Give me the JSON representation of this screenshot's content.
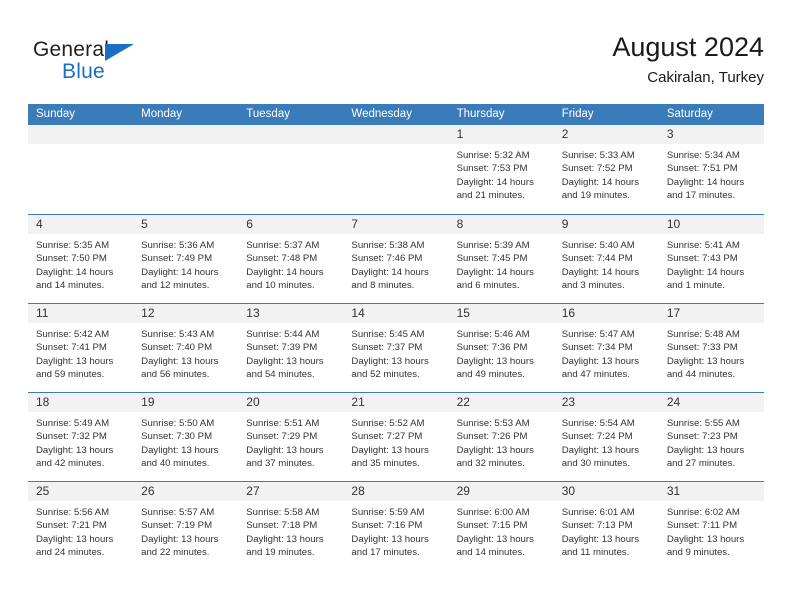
{
  "brand": {
    "name_top": "General",
    "name_bottom": "Blue",
    "accent_color": "#1b6ec2",
    "triangle_icon": "blue-triangle-icon"
  },
  "header": {
    "title": "August 2024",
    "subtitle": "Cakiralan, Turkey"
  },
  "theme": {
    "header_blue": "#3a7cba",
    "day_band_gray": "#f2f2f2",
    "text": "#333333"
  },
  "calendar": {
    "weekday_headers": [
      "Sunday",
      "Monday",
      "Tuesday",
      "Wednesday",
      "Thursday",
      "Friday",
      "Saturday"
    ],
    "weeks": [
      [
        {
          "day": "",
          "sunrise": "",
          "sunset": "",
          "daylight_1": "",
          "daylight_2": ""
        },
        {
          "day": "",
          "sunrise": "",
          "sunset": "",
          "daylight_1": "",
          "daylight_2": ""
        },
        {
          "day": "",
          "sunrise": "",
          "sunset": "",
          "daylight_1": "",
          "daylight_2": ""
        },
        {
          "day": "",
          "sunrise": "",
          "sunset": "",
          "daylight_1": "",
          "daylight_2": ""
        },
        {
          "day": "1",
          "sunrise": "Sunrise: 5:32 AM",
          "sunset": "Sunset: 7:53 PM",
          "daylight_1": "Daylight: 14 hours",
          "daylight_2": "and 21 minutes."
        },
        {
          "day": "2",
          "sunrise": "Sunrise: 5:33 AM",
          "sunset": "Sunset: 7:52 PM",
          "daylight_1": "Daylight: 14 hours",
          "daylight_2": "and 19 minutes."
        },
        {
          "day": "3",
          "sunrise": "Sunrise: 5:34 AM",
          "sunset": "Sunset: 7:51 PM",
          "daylight_1": "Daylight: 14 hours",
          "daylight_2": "and 17 minutes."
        }
      ],
      [
        {
          "day": "4",
          "sunrise": "Sunrise: 5:35 AM",
          "sunset": "Sunset: 7:50 PM",
          "daylight_1": "Daylight: 14 hours",
          "daylight_2": "and 14 minutes."
        },
        {
          "day": "5",
          "sunrise": "Sunrise: 5:36 AM",
          "sunset": "Sunset: 7:49 PM",
          "daylight_1": "Daylight: 14 hours",
          "daylight_2": "and 12 minutes."
        },
        {
          "day": "6",
          "sunrise": "Sunrise: 5:37 AM",
          "sunset": "Sunset: 7:48 PM",
          "daylight_1": "Daylight: 14 hours",
          "daylight_2": "and 10 minutes."
        },
        {
          "day": "7",
          "sunrise": "Sunrise: 5:38 AM",
          "sunset": "Sunset: 7:46 PM",
          "daylight_1": "Daylight: 14 hours",
          "daylight_2": "and 8 minutes."
        },
        {
          "day": "8",
          "sunrise": "Sunrise: 5:39 AM",
          "sunset": "Sunset: 7:45 PM",
          "daylight_1": "Daylight: 14 hours",
          "daylight_2": "and 6 minutes."
        },
        {
          "day": "9",
          "sunrise": "Sunrise: 5:40 AM",
          "sunset": "Sunset: 7:44 PM",
          "daylight_1": "Daylight: 14 hours",
          "daylight_2": "and 3 minutes."
        },
        {
          "day": "10",
          "sunrise": "Sunrise: 5:41 AM",
          "sunset": "Sunset: 7:43 PM",
          "daylight_1": "Daylight: 14 hours",
          "daylight_2": "and 1 minute."
        }
      ],
      [
        {
          "day": "11",
          "sunrise": "Sunrise: 5:42 AM",
          "sunset": "Sunset: 7:41 PM",
          "daylight_1": "Daylight: 13 hours",
          "daylight_2": "and 59 minutes."
        },
        {
          "day": "12",
          "sunrise": "Sunrise: 5:43 AM",
          "sunset": "Sunset: 7:40 PM",
          "daylight_1": "Daylight: 13 hours",
          "daylight_2": "and 56 minutes."
        },
        {
          "day": "13",
          "sunrise": "Sunrise: 5:44 AM",
          "sunset": "Sunset: 7:39 PM",
          "daylight_1": "Daylight: 13 hours",
          "daylight_2": "and 54 minutes."
        },
        {
          "day": "14",
          "sunrise": "Sunrise: 5:45 AM",
          "sunset": "Sunset: 7:37 PM",
          "daylight_1": "Daylight: 13 hours",
          "daylight_2": "and 52 minutes."
        },
        {
          "day": "15",
          "sunrise": "Sunrise: 5:46 AM",
          "sunset": "Sunset: 7:36 PM",
          "daylight_1": "Daylight: 13 hours",
          "daylight_2": "and 49 minutes."
        },
        {
          "day": "16",
          "sunrise": "Sunrise: 5:47 AM",
          "sunset": "Sunset: 7:34 PM",
          "daylight_1": "Daylight: 13 hours",
          "daylight_2": "and 47 minutes."
        },
        {
          "day": "17",
          "sunrise": "Sunrise: 5:48 AM",
          "sunset": "Sunset: 7:33 PM",
          "daylight_1": "Daylight: 13 hours",
          "daylight_2": "and 44 minutes."
        }
      ],
      [
        {
          "day": "18",
          "sunrise": "Sunrise: 5:49 AM",
          "sunset": "Sunset: 7:32 PM",
          "daylight_1": "Daylight: 13 hours",
          "daylight_2": "and 42 minutes."
        },
        {
          "day": "19",
          "sunrise": "Sunrise: 5:50 AM",
          "sunset": "Sunset: 7:30 PM",
          "daylight_1": "Daylight: 13 hours",
          "daylight_2": "and 40 minutes."
        },
        {
          "day": "20",
          "sunrise": "Sunrise: 5:51 AM",
          "sunset": "Sunset: 7:29 PM",
          "daylight_1": "Daylight: 13 hours",
          "daylight_2": "and 37 minutes."
        },
        {
          "day": "21",
          "sunrise": "Sunrise: 5:52 AM",
          "sunset": "Sunset: 7:27 PM",
          "daylight_1": "Daylight: 13 hours",
          "daylight_2": "and 35 minutes."
        },
        {
          "day": "22",
          "sunrise": "Sunrise: 5:53 AM",
          "sunset": "Sunset: 7:26 PM",
          "daylight_1": "Daylight: 13 hours",
          "daylight_2": "and 32 minutes."
        },
        {
          "day": "23",
          "sunrise": "Sunrise: 5:54 AM",
          "sunset": "Sunset: 7:24 PM",
          "daylight_1": "Daylight: 13 hours",
          "daylight_2": "and 30 minutes."
        },
        {
          "day": "24",
          "sunrise": "Sunrise: 5:55 AM",
          "sunset": "Sunset: 7:23 PM",
          "daylight_1": "Daylight: 13 hours",
          "daylight_2": "and 27 minutes."
        }
      ],
      [
        {
          "day": "25",
          "sunrise": "Sunrise: 5:56 AM",
          "sunset": "Sunset: 7:21 PM",
          "daylight_1": "Daylight: 13 hours",
          "daylight_2": "and 24 minutes."
        },
        {
          "day": "26",
          "sunrise": "Sunrise: 5:57 AM",
          "sunset": "Sunset: 7:19 PM",
          "daylight_1": "Daylight: 13 hours",
          "daylight_2": "and 22 minutes."
        },
        {
          "day": "27",
          "sunrise": "Sunrise: 5:58 AM",
          "sunset": "Sunset: 7:18 PM",
          "daylight_1": "Daylight: 13 hours",
          "daylight_2": "and 19 minutes."
        },
        {
          "day": "28",
          "sunrise": "Sunrise: 5:59 AM",
          "sunset": "Sunset: 7:16 PM",
          "daylight_1": "Daylight: 13 hours",
          "daylight_2": "and 17 minutes."
        },
        {
          "day": "29",
          "sunrise": "Sunrise: 6:00 AM",
          "sunset": "Sunset: 7:15 PM",
          "daylight_1": "Daylight: 13 hours",
          "daylight_2": "and 14 minutes."
        },
        {
          "day": "30",
          "sunrise": "Sunrise: 6:01 AM",
          "sunset": "Sunset: 7:13 PM",
          "daylight_1": "Daylight: 13 hours",
          "daylight_2": "and 11 minutes."
        },
        {
          "day": "31",
          "sunrise": "Sunrise: 6:02 AM",
          "sunset": "Sunset: 7:11 PM",
          "daylight_1": "Daylight: 13 hours",
          "daylight_2": "and 9 minutes."
        }
      ]
    ]
  }
}
